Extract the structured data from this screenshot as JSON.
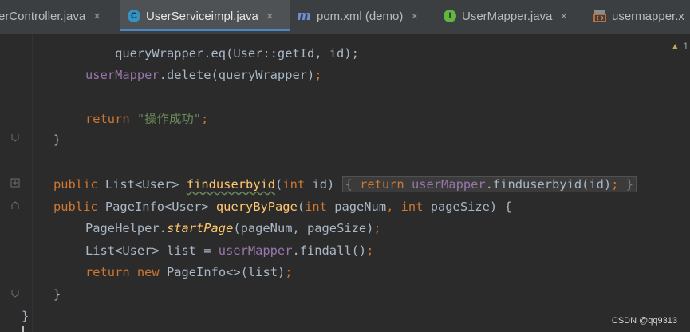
{
  "tabs": [
    {
      "label": "erController.java",
      "icon": "none",
      "active": false
    },
    {
      "label": "UserServiceimpl.java",
      "icon": "class-icon",
      "active": true
    },
    {
      "label": "pom.xml (demo)",
      "icon": "maven-icon",
      "active": false
    },
    {
      "label": "UserMapper.java",
      "icon": "interface-icon",
      "active": false
    },
    {
      "label": "usermapper.x",
      "icon": "xml-icon",
      "active": false
    }
  ],
  "tab_close_glyph": "×",
  "tab_icons": {
    "class": "C",
    "interface": "I",
    "maven": "m",
    "xml": "<>"
  },
  "warning": {
    "icon": "warning-icon",
    "count": "1",
    "color": "#bea45a"
  },
  "code": {
    "line1": {
      "text": "queryWrapper.eq(User::getId, id);"
    },
    "line2": {
      "field": "userMapper",
      "rest": ".delete(queryWrapper)",
      "semi": ";"
    },
    "line3": {
      "kw": "return",
      "str": "\"操作成功\"",
      "semi": ";"
    },
    "line4": {
      "brace": "}"
    },
    "line5": {
      "kw": "public",
      "type": "List<User>",
      "fn": "finduserbyid",
      "paren_open": "(",
      "param_kw": "int",
      "param": "id)",
      "fold_open": "{",
      "kw2": "return",
      "field": "userMapper",
      "call": ".finduserbyid(id)",
      "semi": ";",
      "fold_close": "}"
    },
    "line6": {
      "kw": "public",
      "type": "PageInfo<User>",
      "fn": "queryByPage",
      "paren_open": "(",
      "p1kw": "int",
      "p1": "pageNum",
      "comma": ",",
      "p2kw": "int",
      "p2": "pageSize",
      "tail": ") {"
    },
    "line7": {
      "cls": "PageHelper.",
      "method": "startPage",
      "args": "(pageNum, pageSize)",
      "semi": ";"
    },
    "line8": {
      "type": "List<User> list = ",
      "field": "userMapper",
      "call": ".findall()",
      "semi": ";"
    },
    "line9": {
      "kw": "return",
      "kw2": "new",
      "rest": "PageInfo<>(list)",
      "semi": ";"
    },
    "line10": {
      "brace": "}"
    },
    "line11": {
      "brace": "}"
    }
  },
  "watermark": "CSDN @qq9313",
  "colors": {
    "background": "#2b2b2b",
    "keyword": "#cc7832",
    "field": "#9876aa",
    "string": "#6a8759",
    "function": "#ffc66d",
    "text": "#a9b7c6"
  }
}
